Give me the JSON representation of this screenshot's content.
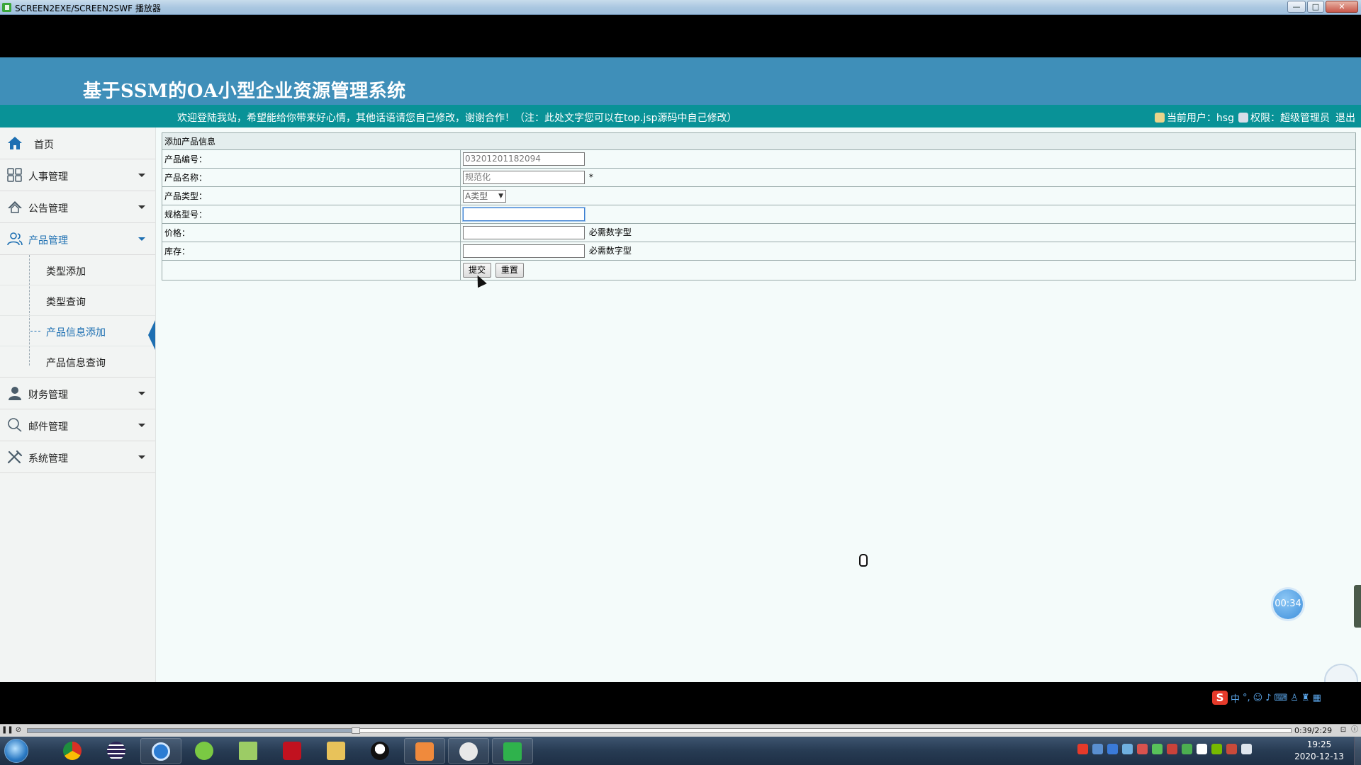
{
  "window": {
    "title": "SCREEN2EXE/SCREEN2SWF 播放器",
    "minimize": "—",
    "maximize": "□",
    "close": "✕"
  },
  "site": {
    "title": "基于SSM的OA小型企业资源管理系统",
    "welcome": "欢迎登陆我站，希望能给你带来好心情，其他话语请您自己修改，谢谢合作！（注：此处文字您可以在top.jsp源码中自己修改）",
    "user_label": "当前用户：hsg",
    "role_label": "权限：超级管理员",
    "logout": "退出"
  },
  "sidebar": {
    "home": "首页",
    "hr": "人事管理",
    "notice": "公告管理",
    "product": "产品管理",
    "product_sub": [
      "类型添加",
      "类型查询",
      "产品信息添加",
      "产品信息查询"
    ],
    "finance": "财务管理",
    "mail": "邮件管理",
    "system": "系统管理"
  },
  "form": {
    "caption": "添加产品信息",
    "code_label": "产品编号：",
    "code_value": "03201201182094",
    "name_label": "产品名称：",
    "name_value": "规范化",
    "name_required": "*",
    "type_label": "产品类型：",
    "type_value": "A类型",
    "spec_label": "规格型号：",
    "spec_value": "",
    "price_label": "价格：",
    "price_value": "",
    "price_hint": "必需数字型",
    "stock_label": "库存：",
    "stock_value": "",
    "stock_hint": "必需数字型",
    "submit": "提交",
    "reset": "重置"
  },
  "overlay": {
    "timer": "00:34"
  },
  "player": {
    "time": "0:39/2:29",
    "progress": 0.26
  },
  "ime": {
    "lang": "中"
  },
  "taskbar": {
    "time": "19:25",
    "date": "2020-12-13"
  },
  "colors": {
    "header": "#3f8fb9",
    "infobar": "#099297",
    "accent": "#1d6fb2"
  }
}
